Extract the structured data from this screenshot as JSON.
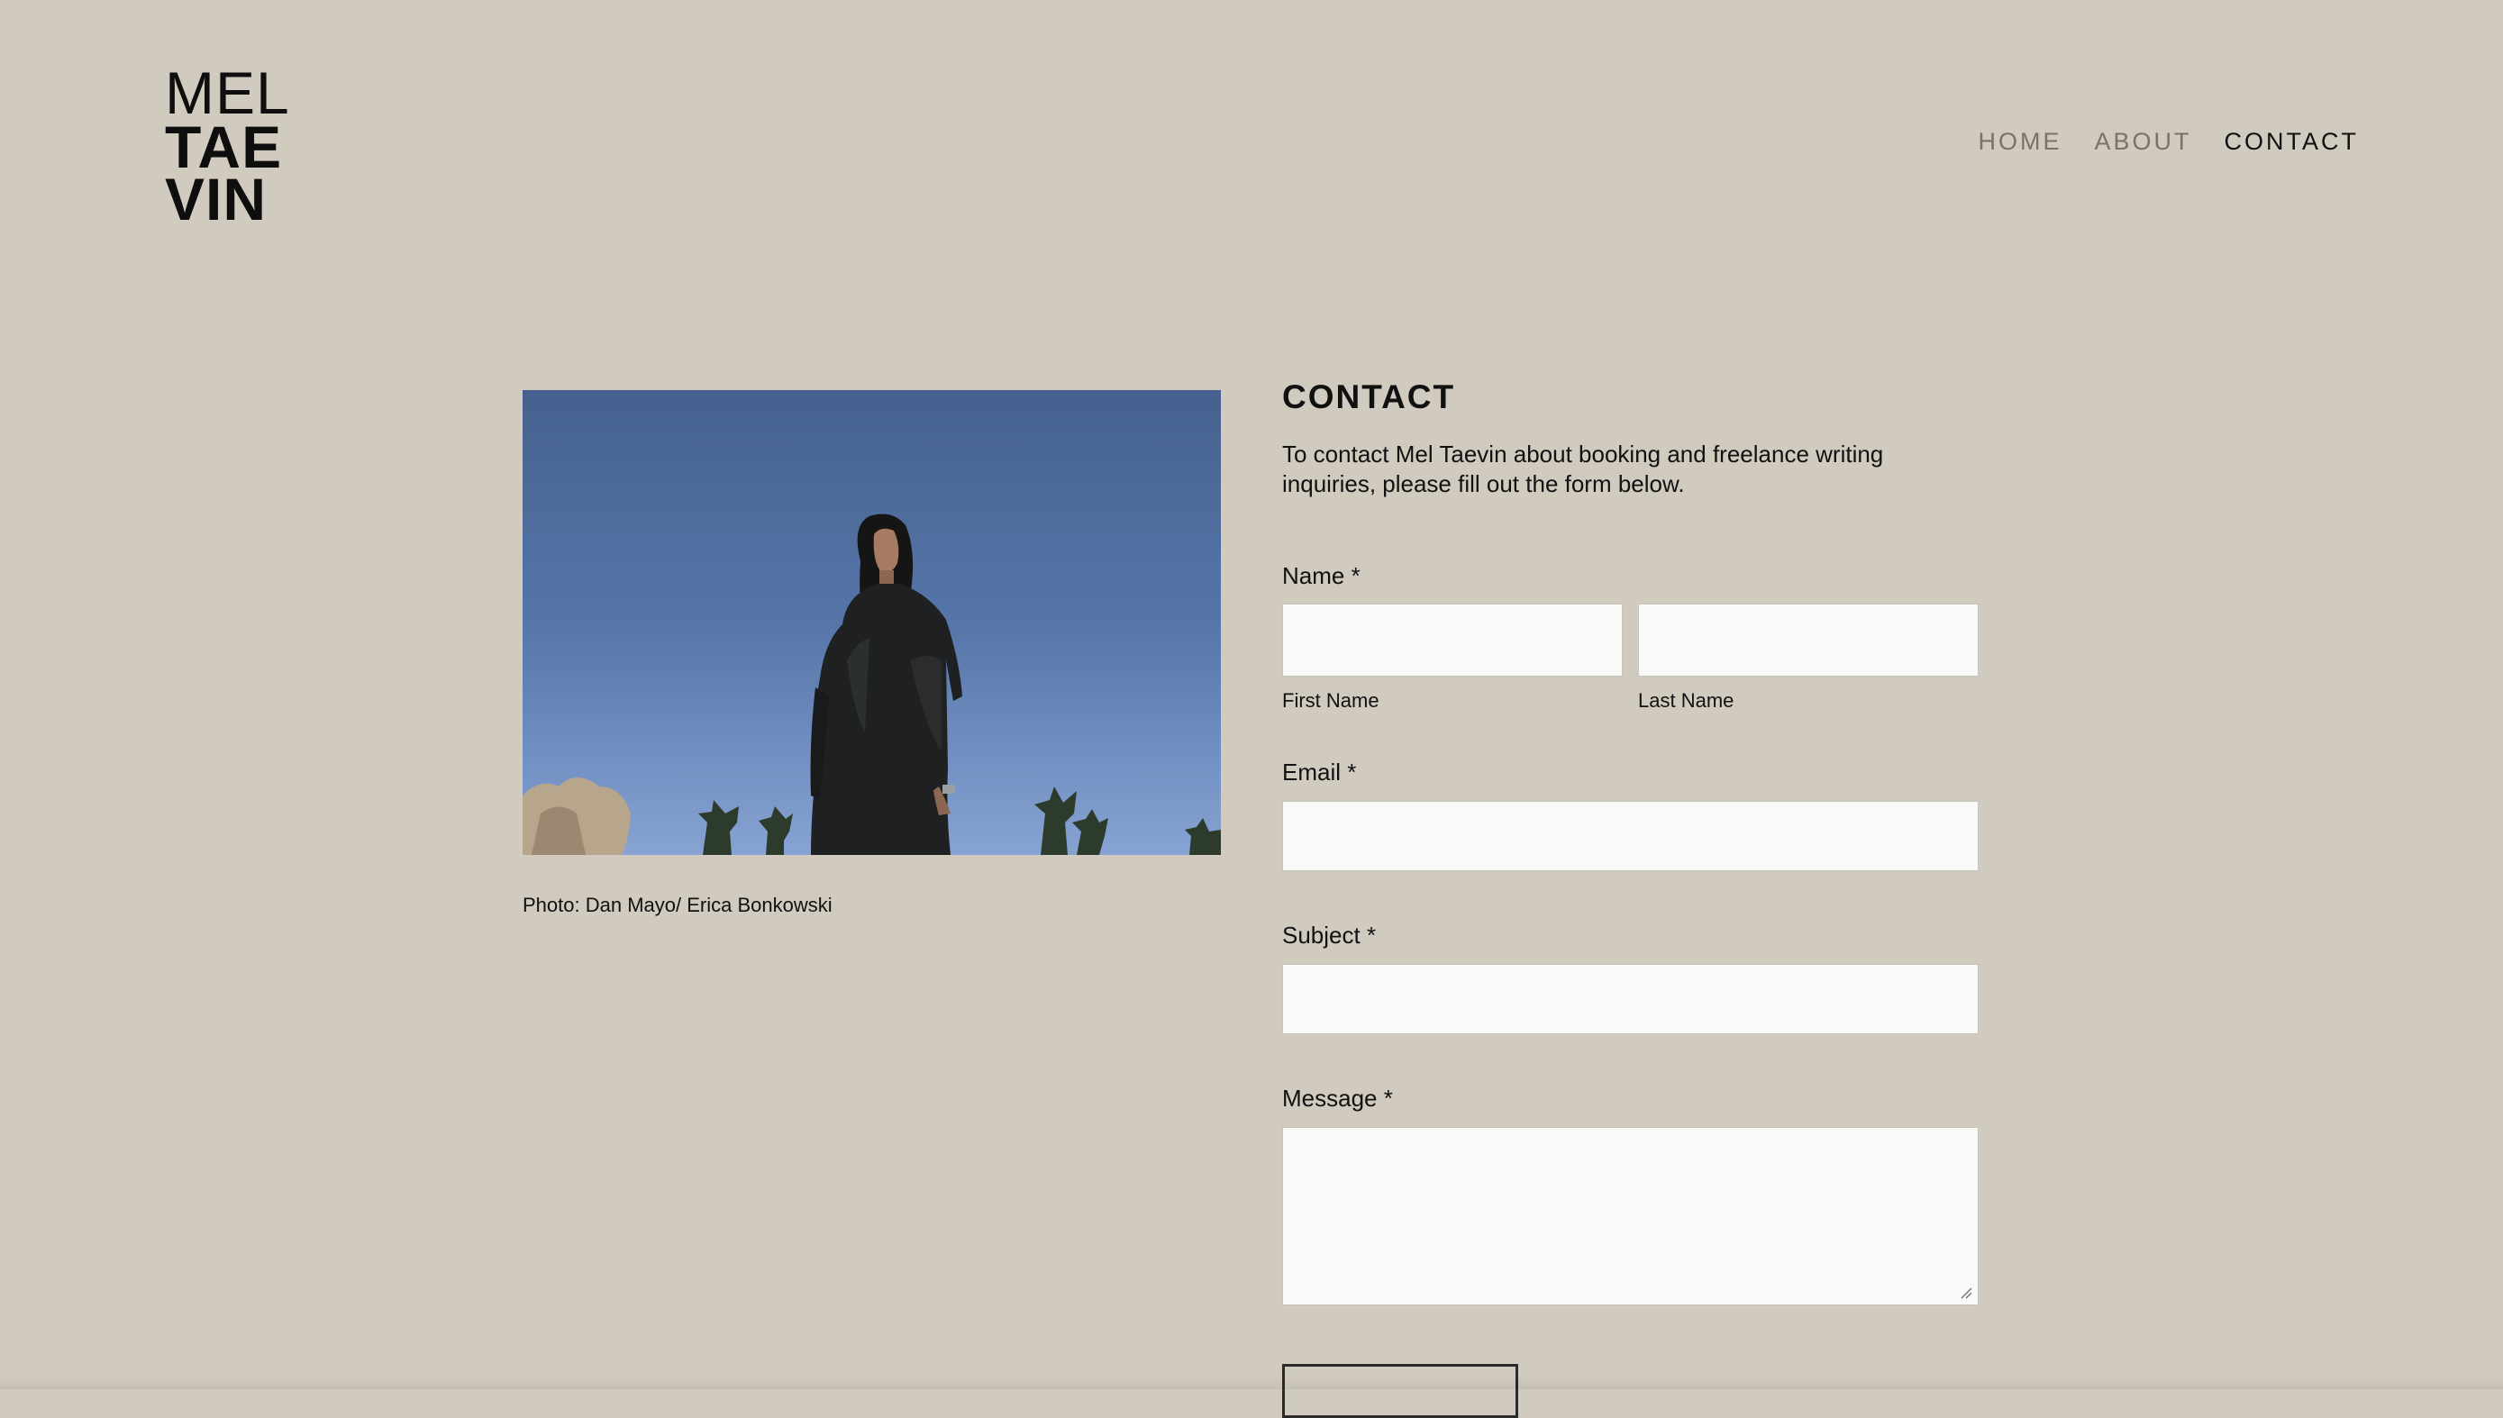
{
  "site": {
    "logo": {
      "line1": "MEL",
      "line2": "TAE",
      "line3": "VIN"
    }
  },
  "nav": {
    "items": [
      {
        "label": "HOME"
      },
      {
        "label": "ABOUT"
      },
      {
        "label": "CONTACT"
      }
    ],
    "active": "CONTACT"
  },
  "photo": {
    "caption": "Photo: Dan Mayo/ Erica Bonkowski"
  },
  "contact": {
    "title": "CONTACT",
    "intro": "To contact Mel Taevin about booking and freelance writing inquiries, please fill out the form below.",
    "fields": {
      "name_label": "Name *",
      "first_name_sublabel": "First Name",
      "last_name_sublabel": "Last Name",
      "email_label": "Email *",
      "subject_label": "Subject *",
      "message_label": "Message *"
    },
    "values": {
      "first_name": "",
      "last_name": "",
      "email": "",
      "subject": "",
      "message": ""
    }
  },
  "colors": {
    "background": "#d1cabe",
    "field_background": "#f9f9f8",
    "text": "#111111",
    "nav_inactive": "#77736c"
  }
}
